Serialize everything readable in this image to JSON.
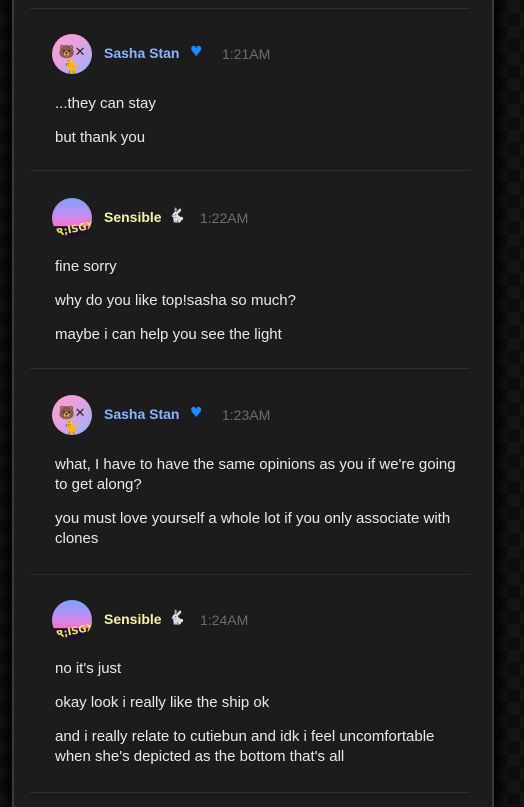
{
  "messages": [
    {
      "author": "Sasha Stan",
      "badge_icon": "blue-heart",
      "time": "1:21AM",
      "lines": [
        "...they can stay",
        "but thank you"
      ]
    },
    {
      "author": "Sensible",
      "badge_icon": "bunny",
      "time": "1:22AM",
      "lines": [
        "fine sorry",
        "why do you like top!sasha so much?",
        "maybe i can help you see the light"
      ]
    },
    {
      "author": "Sasha Stan",
      "badge_icon": "blue-heart",
      "time": "1:23AM",
      "lines": [
        "what, I have to have the same opinions as you if we're going to get along?",
        "you must love yourself a whole lot if you only associate with clones"
      ]
    },
    {
      "author": "Sensible",
      "badge_icon": "bunny",
      "time": "1:24AM",
      "lines": [
        "no it's just",
        "okay look i really like the ship ok",
        "and i really relate to cutiebun and idk i feel uncomfortable when she's depicted as the bottom that's all"
      ]
    }
  ],
  "avatar_text": {
    "sensible": "R;ISGX"
  },
  "colors": {
    "panel": "#1c1c1d",
    "sasha_name": "#8ab4ff",
    "sensible_name": "#f5f1a8",
    "timestamp": "#6c6c6e",
    "message_text": "#e8e8e8"
  }
}
